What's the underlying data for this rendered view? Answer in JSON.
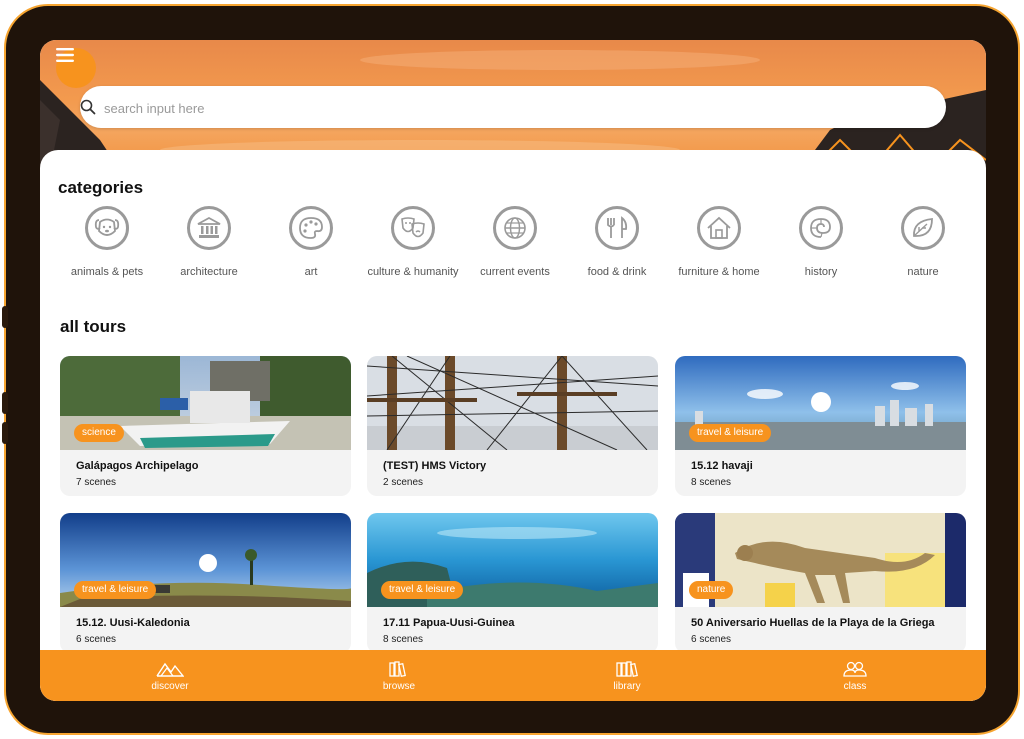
{
  "search": {
    "placeholder": "search input here"
  },
  "categories": {
    "heading": "categories",
    "items": [
      {
        "label": "animals & pets",
        "icon": "dog-icon"
      },
      {
        "label": "architecture",
        "icon": "building-icon"
      },
      {
        "label": "art",
        "icon": "palette-icon"
      },
      {
        "label": "culture & humanity",
        "icon": "theater-masks-icon"
      },
      {
        "label": "current events",
        "icon": "globe-icon"
      },
      {
        "label": "food & drink",
        "icon": "fork-knife-icon"
      },
      {
        "label": "furniture & home",
        "icon": "house-icon"
      },
      {
        "label": "history",
        "icon": "ammonite-icon"
      },
      {
        "label": "nature",
        "icon": "leaf-icon"
      }
    ]
  },
  "tours": {
    "heading": "all tours",
    "items": [
      {
        "title": "Galápagos Archipelago",
        "scenes": "7 scenes",
        "tag": "science"
      },
      {
        "title": "(TEST) HMS Victory",
        "scenes": "2 scenes",
        "tag": ""
      },
      {
        "title": "15.12 havaji",
        "scenes": "8 scenes",
        "tag": "travel & leisure"
      },
      {
        "title": "15.12. Uusi-Kaledonia",
        "scenes": "6 scenes",
        "tag": "travel & leisure"
      },
      {
        "title": "17.11 Papua-Uusi-Guinea",
        "scenes": "8 scenes",
        "tag": "travel & leisure"
      },
      {
        "title": "50 Aniversario Huellas de la Playa de la Griega",
        "scenes": "6 scenes",
        "tag": "nature"
      }
    ]
  },
  "nav": {
    "items": [
      {
        "label": "discover",
        "icon": "mountains-icon"
      },
      {
        "label": "browse",
        "icon": "books-icon"
      },
      {
        "label": "library",
        "icon": "bookshelf-icon"
      },
      {
        "label": "class",
        "icon": "group-icon"
      }
    ]
  },
  "colors": {
    "accent": "#f7931e",
    "frame": "#1f130a",
    "icon_gray": "#9a9a9a"
  }
}
